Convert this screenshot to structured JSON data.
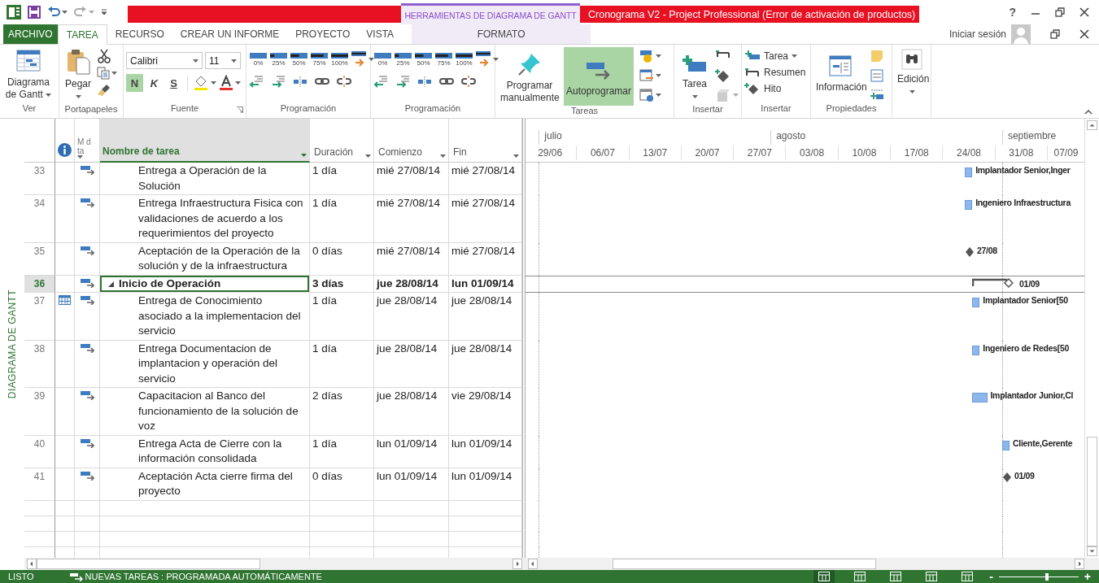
{
  "title_bar": {
    "contextual_label": "HERRAMIENTAS DE DIAGRAMA DE GANTT",
    "title": "Cronograma V2 -  Project Professional (Error de activación de productos)",
    "help": "?"
  },
  "ribbon_tabs": [
    {
      "label": "ARCHIVO",
      "kind": "file",
      "selected": false
    },
    {
      "label": "TAREA",
      "kind": "tab",
      "selected": true
    },
    {
      "label": "RECURSO",
      "kind": "tab",
      "selected": false
    },
    {
      "label": "CREAR UN INFORME",
      "kind": "tab",
      "selected": false
    },
    {
      "label": "PROYECTO",
      "kind": "tab",
      "selected": false
    },
    {
      "label": "VISTA",
      "kind": "tab",
      "selected": false
    },
    {
      "label": "FORMATO",
      "kind": "contextual",
      "selected": false
    }
  ],
  "account": {
    "sign_in": "Iniciar sesión"
  },
  "ribbon_groups": [
    {
      "kind": "view",
      "label": "Ver",
      "button": "Diagrama de Gantt"
    },
    {
      "kind": "clipboard",
      "label": "Portapapeles",
      "button": "Pegar"
    },
    {
      "kind": "font",
      "label": "Fuente",
      "font": "Calibri",
      "size": "11",
      "styles": [
        {
          "label": "N",
          "selected": true
        },
        {
          "label": "K",
          "selected": false
        },
        {
          "label": "S",
          "selected": false
        }
      ]
    },
    {
      "kind": "schedule",
      "label": "Programación",
      "percents": [
        "0%",
        "25%",
        "50%",
        "75%",
        "100%"
      ]
    },
    {
      "kind": "schedule",
      "label": "Programación",
      "percents": [
        "0%",
        "25%",
        "50%",
        "75%",
        "100%"
      ]
    },
    {
      "kind": "tasks",
      "label": "Tareas",
      "buttons": [
        {
          "label": "Programar manualmente",
          "selected": false
        },
        {
          "label": "Autoprogramar",
          "selected": true
        }
      ]
    },
    {
      "kind": "insert",
      "label": "Insertar",
      "button": "Tarea"
    },
    {
      "kind": "insert-items",
      "label": "Insertar",
      "items": [
        "Tarea",
        "Resumen",
        "Hito"
      ]
    },
    {
      "kind": "properties",
      "label": "Propiedades",
      "button": "Información"
    },
    {
      "kind": "editing",
      "button": "Edición"
    }
  ],
  "side_label": "DIAGRAMA DE GANTT",
  "table": {
    "columns": [
      {
        "kind": "info",
        "selected": false
      },
      {
        "kind": "mode",
        "label": "M d ta",
        "selected": false
      },
      {
        "kind": "name",
        "label": "Nombre de tarea",
        "selected": true
      },
      {
        "kind": "duration",
        "label": "Duración",
        "selected": false
      },
      {
        "kind": "start",
        "label": "Comienzo",
        "selected": false
      },
      {
        "kind": "finish",
        "label": "Fin",
        "selected": false
      }
    ],
    "rows": [
      {
        "id": "33",
        "calendar": false,
        "summary": false,
        "selected": false,
        "name": "Entrega a Operación de la Solución",
        "duration": "1 día",
        "start": "mié 27/08/14",
        "finish": "mié 27/08/14",
        "gantt": {
          "kind": "task",
          "label": "Implantador Senior,Inger"
        }
      },
      {
        "id": "34",
        "calendar": false,
        "summary": false,
        "selected": false,
        "name": "Entrega Infraestructura Fisica con validaciones de acuerdo a los requerimientos del proyecto",
        "duration": "1 día",
        "start": "mié 27/08/14",
        "finish": "mié 27/08/14",
        "gantt": {
          "kind": "task",
          "label": "Ingeniero Infraestructura"
        }
      },
      {
        "id": "35",
        "calendar": false,
        "summary": false,
        "selected": false,
        "name": "Aceptación de la Operación de la solución y de la infraestructura",
        "duration": "0 días",
        "start": "mié 27/08/14",
        "finish": "mié 27/08/14",
        "gantt": {
          "kind": "milestone",
          "label": "27/08"
        }
      },
      {
        "id": "36",
        "calendar": false,
        "summary": true,
        "expanded": true,
        "selected": true,
        "name": "Inicio de Operación",
        "duration": "3 días",
        "start": "jue 28/08/14",
        "finish": "lun 01/09/14",
        "gantt": {
          "kind": "summary",
          "label": "01/09"
        }
      },
      {
        "id": "37",
        "calendar": true,
        "summary": false,
        "selected": false,
        "name": "Entrega de Conocimiento asociado a la implementacion del servicio",
        "duration": "1 día",
        "start": "jue 28/08/14",
        "finish": "jue 28/08/14",
        "gantt": {
          "kind": "task",
          "label": "Implantador Senior[50"
        }
      },
      {
        "id": "38",
        "calendar": false,
        "summary": false,
        "selected": false,
        "name": "Entrega Documentacion de implantacion y operación del servicio",
        "duration": "1 día",
        "start": "jue 28/08/14",
        "finish": "jue 28/08/14",
        "gantt": {
          "kind": "task",
          "label": "Ingeniero de Redes[50"
        }
      },
      {
        "id": "39",
        "calendar": false,
        "summary": false,
        "selected": false,
        "name": "Capacitacion al Banco del funcionamiento de la solución de voz",
        "duration": "2 días",
        "start": "jue 28/08/14",
        "finish": "vie 29/08/14",
        "gantt": {
          "kind": "task",
          "label": "Implantador Junior,Cl"
        }
      },
      {
        "id": "40",
        "calendar": false,
        "summary": false,
        "selected": false,
        "name": "Entrega Acta de Cierre con la información consolidada",
        "duration": "1 día",
        "start": "lun 01/09/14",
        "finish": "lun 01/09/14",
        "gantt": {
          "kind": "task",
          "label": "Cliente,Gerente"
        }
      },
      {
        "id": "41",
        "calendar": false,
        "summary": false,
        "selected": false,
        "name": "Aceptación Acta cierre firma del proyecto",
        "duration": "0 días",
        "start": "lun 01/09/14",
        "finish": "lun 01/09/14",
        "gantt": {
          "kind": "milestone",
          "label": "01/09"
        }
      }
    ]
  },
  "timeline": {
    "months": [
      "julio",
      "agosto",
      "septiembre"
    ],
    "weeks": [
      "29/06",
      "06/07",
      "13/07",
      "20/07",
      "27/07",
      "03/08",
      "10/08",
      "17/08",
      "24/08",
      "31/08",
      "07/09"
    ]
  },
  "status_bar": {
    "ready": "LISTO",
    "new_tasks": "NUEVAS TAREAS : PROGRAMADA AUTOMÁTICAMENTE",
    "views": [
      {
        "selected": true
      },
      {
        "selected": false
      },
      {
        "selected": false
      },
      {
        "selected": false
      },
      {
        "selected": false
      }
    ],
    "zoom": {
      "minus": "-",
      "plus": "+",
      "level": 0.6
    }
  }
}
